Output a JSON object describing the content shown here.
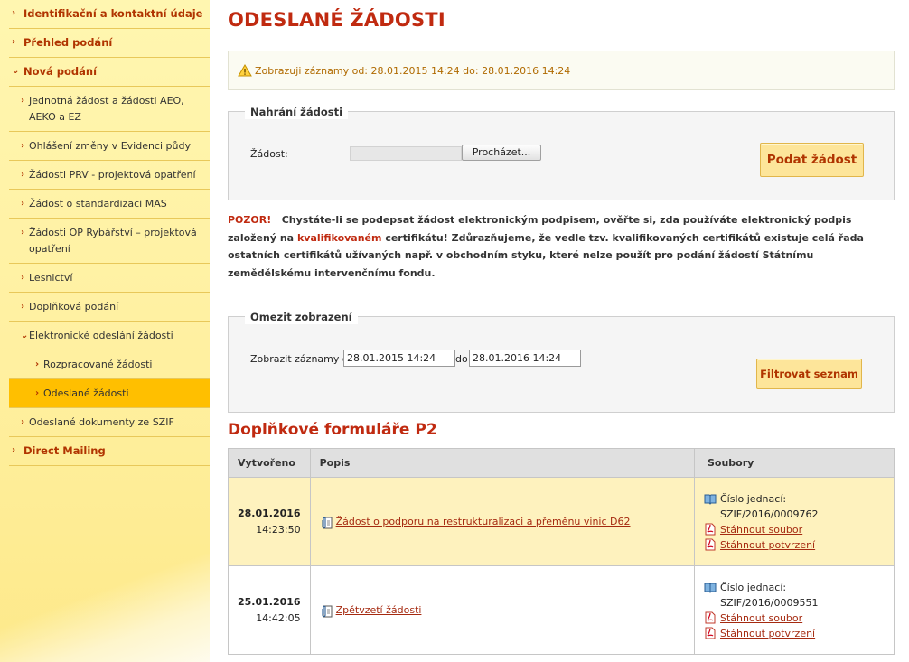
{
  "sidebar": {
    "items": [
      {
        "label": "Identifikační a kontaktní údaje",
        "level": "top",
        "chevron": "›",
        "active": false
      },
      {
        "label": "Přehled podání",
        "level": "top",
        "chevron": "›",
        "active": false
      },
      {
        "label": "Nová podání",
        "level": "top",
        "chevron": "⌄",
        "active": false
      },
      {
        "label": "Jednotná žádost a žádosti AEO, AEKO a EZ",
        "level": "sub",
        "chevron": "›",
        "active": false
      },
      {
        "label": "Ohlášení změny v Evidenci půdy",
        "level": "sub",
        "chevron": "›",
        "active": false
      },
      {
        "label": "Žádosti PRV - projektová opatření",
        "level": "sub",
        "chevron": "›",
        "active": false
      },
      {
        "label": "Žádost o standardizaci MAS",
        "level": "sub",
        "chevron": "›",
        "active": false
      },
      {
        "label": "Žádosti OP Rybářství – projektová opatření",
        "level": "sub",
        "chevron": "›",
        "active": false
      },
      {
        "label": "Lesnictví",
        "level": "sub",
        "chevron": "›",
        "active": false
      },
      {
        "label": "Doplňková podání",
        "level": "sub",
        "chevron": "›",
        "active": false
      },
      {
        "label": "Elektronické odeslání žádosti",
        "level": "sub",
        "chevron": "⌄",
        "active": false
      },
      {
        "label": "Rozpracované žádosti",
        "level": "subsub",
        "chevron": "›",
        "active": false
      },
      {
        "label": "Odeslané žádosti",
        "level": "subsub",
        "chevron": "›",
        "active": true
      },
      {
        "label": "Odeslané dokumenty ze SZIF",
        "level": "sub",
        "chevron": "›",
        "active": false
      },
      {
        "label": "Direct Mailing",
        "level": "top",
        "chevron": "›",
        "active": false
      }
    ]
  },
  "page_title": "ODESLANÉ ŽÁDOSTI",
  "info_message": "Zobrazuji záznamy od: 28.01.2015 14:24 do: 28.01.2016 14:24",
  "upload": {
    "legend": "Nahrání žádosti",
    "field_label": "Žádost:",
    "browse_label": "Procházet...",
    "submit_label": "Podat žádost"
  },
  "warning": {
    "alert": "POZOR!",
    "text1": "Chystáte-li se podepsat žádost elektronickým podpisem, ověřte si, zda používáte elektronický podpis založený na",
    "highlight": "kvalifikovaném",
    "text2": "certifikátu! Zdůrazňujeme, že vedle tzv. kvalifikovaných certifikátů existuje celá řada ostatních certifikátů užívaných např. v obchodním styku, které nelze použít pro podání žádostí Státnímu zemědělskému intervenčnímu fondu."
  },
  "filter": {
    "legend": "Omezit zobrazení",
    "label_from": "Zobrazit záznamy od",
    "from_value": "28.01.2015 14:24",
    "label_to": "do",
    "to_value": "28.01.2016 14:24",
    "button_label": "Filtrovat seznam"
  },
  "section_title": "Doplňkové formuláře P2",
  "table": {
    "headers": [
      "Vytvořeno",
      "Popis",
      "Soubory"
    ],
    "rows": [
      {
        "date": "28.01.2016",
        "time": "14:23:50",
        "description": "Žádost o podporu na restrukturalizaci a přeměnu vinic D62",
        "ref_label": "Číslo jednací:",
        "ref_number": "SZIF/2016/0009762",
        "download_file": "Stáhnout soubor",
        "download_confirmation": "Stáhnout potvrzení"
      },
      {
        "date": "25.01.2016",
        "time": "14:42:05",
        "description": "Zpětvzetí žádosti",
        "ref_label": "Číslo jednací:",
        "ref_number": "SZIF/2016/0009551",
        "download_file": "Stáhnout soubor",
        "download_confirmation": "Stáhnout potvrzení"
      }
    ]
  },
  "colors": {
    "accent": "#c02a10",
    "sidebar_bg": "#fff3a8",
    "active_item": "#ffbf00",
    "button_bg": "#fde59a"
  },
  "icons": {
    "warning": "warning-triangle-icon",
    "document": "document-clip-icon",
    "book": "book-icon",
    "pdf": "pdf-icon"
  }
}
